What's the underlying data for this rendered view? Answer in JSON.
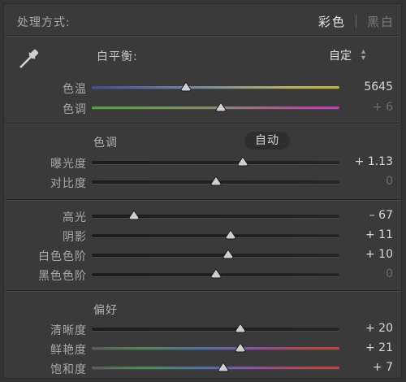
{
  "header": {
    "title": "处理方式:",
    "mode_color": "彩色",
    "mode_bw": "黑白"
  },
  "white_balance": {
    "label": "白平衡:",
    "value": "自定",
    "arrow": "⇕"
  },
  "tone": {
    "section_label": "色调",
    "auto_label": "自动"
  },
  "presence": {
    "section_label": "偏好"
  },
  "sliders": {
    "temp": {
      "name": "色温",
      "value": "5645",
      "fraction": 0.38,
      "dim": false,
      "track": "temp"
    },
    "tint": {
      "name": "色调",
      "value": "+ 6",
      "fraction": 0.52,
      "dim": true,
      "track": "tint"
    },
    "exposure": {
      "name": "曝光度",
      "value": "+ 1.13",
      "fraction": 0.61,
      "dim": false,
      "track": "gray"
    },
    "contrast": {
      "name": "对比度",
      "value": "0",
      "fraction": 0.5,
      "dim": true,
      "track": "gray"
    },
    "highlights": {
      "name": "高光",
      "value": "– 67",
      "fraction": 0.17,
      "dim": false,
      "track": "gray"
    },
    "shadows": {
      "name": "阴影",
      "value": "+ 11",
      "fraction": 0.56,
      "dim": false,
      "track": "gray"
    },
    "whites": {
      "name": "白色色阶",
      "value": "+ 10",
      "fraction": 0.55,
      "dim": false,
      "track": "gray"
    },
    "blacks": {
      "name": "黑色色阶",
      "value": "0",
      "fraction": 0.5,
      "dim": true,
      "track": "gray"
    },
    "clarity": {
      "name": "清晰度",
      "value": "+ 20",
      "fraction": 0.6,
      "dim": false,
      "track": "gray"
    },
    "vibrance": {
      "name": "鲜艳度",
      "value": "+ 21",
      "fraction": 0.6,
      "dim": false,
      "track": "vib"
    },
    "saturation": {
      "name": "饱和度",
      "value": "+ 7",
      "fraction": 0.53,
      "dim": false,
      "track": "vib"
    }
  },
  "colors": {
    "accent": "#e8e8e8",
    "track": "#1f1f1f",
    "panel": "#3a3a3a"
  },
  "icons": {
    "eyedropper": "eyedropper-icon"
  }
}
